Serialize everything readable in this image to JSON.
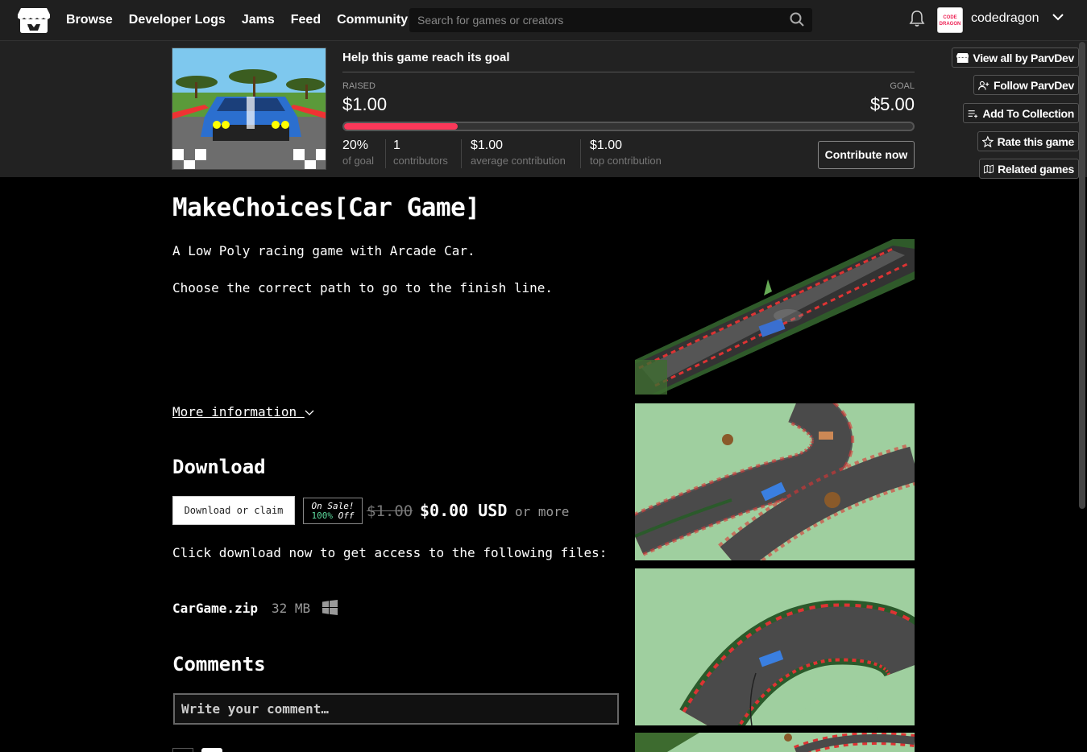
{
  "nav": {
    "items": [
      "Browse",
      "Developer Logs",
      "Jams",
      "Feed",
      "Community"
    ],
    "search_placeholder": "Search for games or creators",
    "username": "codedragon",
    "avatar_text": "CODE DRAGON"
  },
  "fundraiser": {
    "title": "Help this game reach its goal",
    "raised_label": "RAISED",
    "raised_value": "$1.00",
    "goal_label": "GOAL",
    "goal_value": "$5.00",
    "progress_fraction": 0.2,
    "stats": [
      {
        "value": "20%",
        "label": "of goal"
      },
      {
        "value": "1",
        "label": "contributors"
      },
      {
        "value": "$1.00",
        "label": "average contribution"
      },
      {
        "value": "$1.00",
        "label": "top contribution"
      }
    ],
    "contribute_label": "Contribute now"
  },
  "side_buttons": [
    {
      "label": "View all by ParvDev",
      "icon": "itchio-icon"
    },
    {
      "label": "Follow ParvDev",
      "icon": "follow-user-icon"
    },
    {
      "label": "Add To Collection",
      "icon": "add-list-icon"
    },
    {
      "label": "Rate this game",
      "icon": "star-icon"
    },
    {
      "label": "Related games",
      "icon": "map-icon"
    }
  ],
  "game": {
    "title": "MakeChoices[Car Game]",
    "desc1": "A Low Poly racing game with Arcade Car.",
    "desc2": "Choose the correct path to go to the finish line.",
    "more_info": "More information"
  },
  "download": {
    "heading": "Download",
    "button_label": "Download or claim",
    "sale_line1": "On Sale!",
    "sale_pct": "100%",
    "sale_off": "Off",
    "old_price": "$1.00",
    "new_price": "$0.00 USD",
    "or_more": "or more",
    "instructions": "Click download now to get access to the following files:",
    "file_name": "CarGame.zip",
    "file_size": "32 MB"
  },
  "comments": {
    "heading": "Comments",
    "placeholder": "Write your comment…"
  },
  "colors": {
    "accent": "#fa3859",
    "background": "#000000",
    "panel": "#222222",
    "sale_green": "#5ddb9e"
  }
}
